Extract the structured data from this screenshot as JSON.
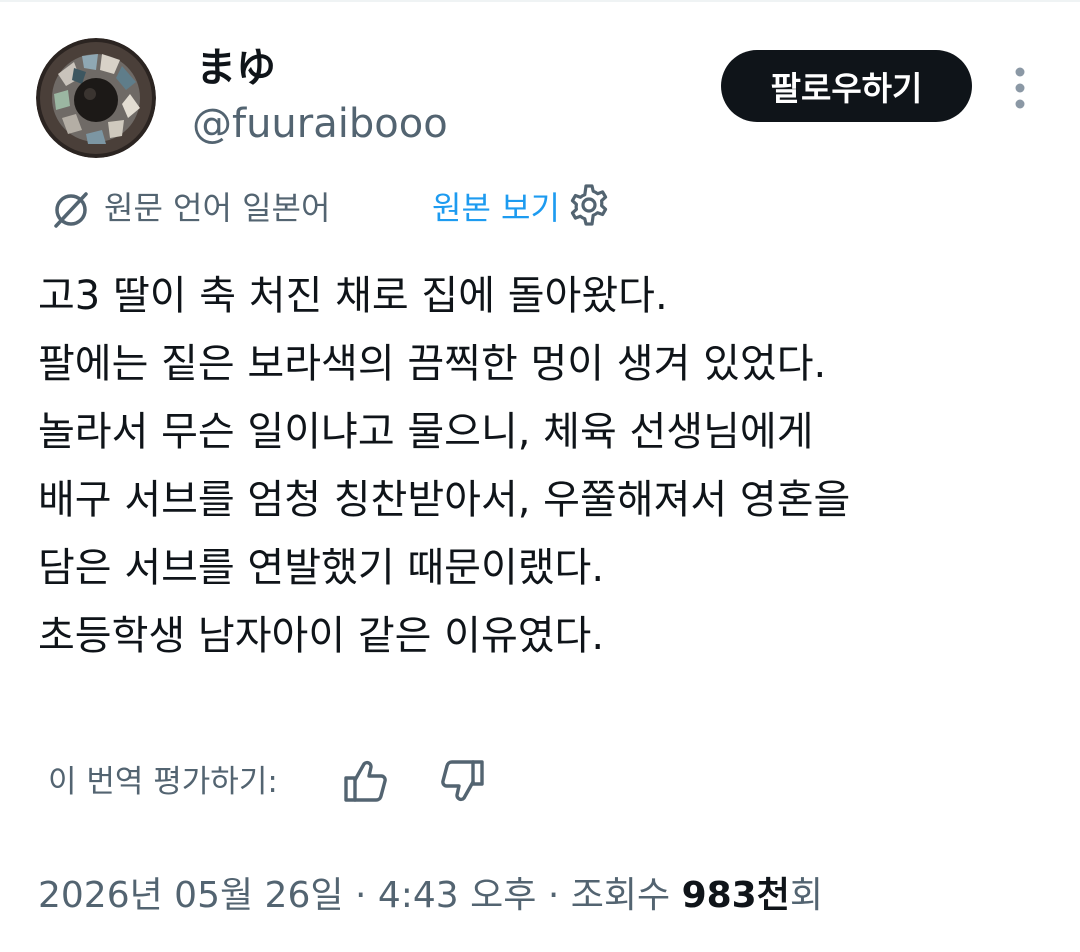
{
  "author": {
    "display_name": "まゆ",
    "handle": "@fuuraibooo",
    "avatar_icon": "mosaic-avatar"
  },
  "follow_button": {
    "label": "팔로우하기"
  },
  "more_menu": {
    "icon": "vertical-ellipsis-icon"
  },
  "translation": {
    "icon": "translate-icon",
    "source_language": "원문 언어 일본어",
    "show_original_label": "원본 보기",
    "settings_icon": "gear-icon"
  },
  "tweet": {
    "lines": [
      "고3 딸이 축 처진 채로 집에 돌아왔다.",
      "팔에는 짙은 보라색의 끔찍한 멍이 생겨 있었다.",
      "놀라서 무슨 일이냐고 물으니, 체육 선생님에게",
      "배구 서브를 엄청 칭찬받아서, 우쭐해져서 영혼을",
      "담은 서브를 연발했기 때문이랬다.",
      "초등학생 남자아이 같은 이유였다."
    ]
  },
  "rating": {
    "label": "이 번역 평가하기:",
    "thumbs_up_icon": "thumbs-up-icon",
    "thumbs_down_icon": "thumbs-down-icon"
  },
  "meta": {
    "date": "2026년 05월 26일",
    "separator": "·",
    "time": "4:43 오후",
    "views_label": "조회수",
    "views_count": "983천",
    "views_suffix": "회"
  },
  "colors": {
    "text_primary": "#0f1419",
    "text_secondary": "#536471",
    "link": "#1d9bf0",
    "button_bg": "#0f1419",
    "button_text": "#ffffff"
  }
}
